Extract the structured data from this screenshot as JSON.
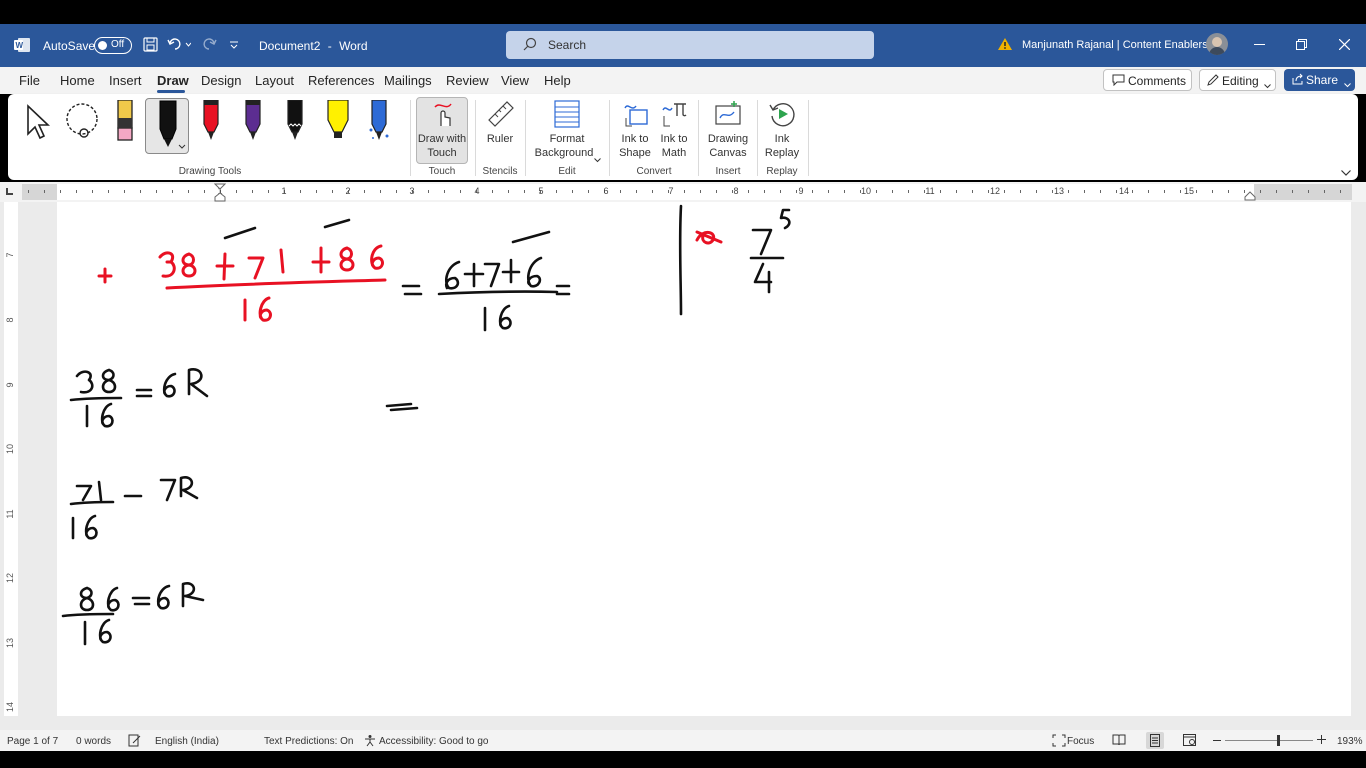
{
  "titlebar": {
    "autosave_label": "AutoSave",
    "autosave_state": "Off",
    "doc_title": "Document2",
    "title_sep": "-",
    "app_name": "Word",
    "search_placeholder": "Search",
    "user_name": "Manjunath Rajanal | Content Enablers"
  },
  "menu": {
    "items": [
      "File",
      "Home",
      "Insert",
      "Draw",
      "Design",
      "Layout",
      "References",
      "Mailings",
      "Review",
      "View",
      "Help"
    ],
    "active": "Draw",
    "comments_label": "Comments",
    "editing_label": "Editing",
    "share_label": "Share"
  },
  "ribbon": {
    "groups": {
      "drawing_tools": "Drawing Tools",
      "touch": "Touch",
      "stencils": "Stencils",
      "edit": "Edit",
      "convert": "Convert",
      "insert": "Insert",
      "replay": "Replay"
    },
    "buttons": {
      "draw_with_touch": [
        "Draw with",
        "Touch"
      ],
      "ruler": "Ruler",
      "format_background": [
        "Format",
        "Background"
      ],
      "ink_to_shape": [
        "Ink to",
        "Shape"
      ],
      "ink_to_math": [
        "Ink to",
        "Math"
      ],
      "drawing_canvas": [
        "Drawing",
        "Canvas"
      ],
      "ink_replay": [
        "Ink",
        "Replay"
      ]
    },
    "pen_colors": [
      "#f4cdd8",
      "#1a1a1a",
      "#e81123",
      "#5c2d91",
      "#1a1a1a",
      "#fff100",
      "#2d6ad6"
    ]
  },
  "ruler": {
    "numbers": [
      "1",
      "1",
      "2",
      "3",
      "4",
      "5",
      "6",
      "7",
      "8",
      "9",
      "10",
      "11",
      "12",
      "13",
      "14",
      "15"
    ],
    "vertical_numbers": [
      "7",
      "8",
      "9",
      "10",
      "11",
      "12",
      "13",
      "14"
    ]
  },
  "ink": {
    "red_color": "#e81123",
    "black_color": "#111111"
  },
  "status": {
    "page": "Page 1 of 7",
    "words": "0 words",
    "language": "English (India)",
    "text_predictions": "Text Predictions: On",
    "accessibility": "Accessibility: Good to go",
    "focus": "Focus",
    "zoom": "193%"
  }
}
